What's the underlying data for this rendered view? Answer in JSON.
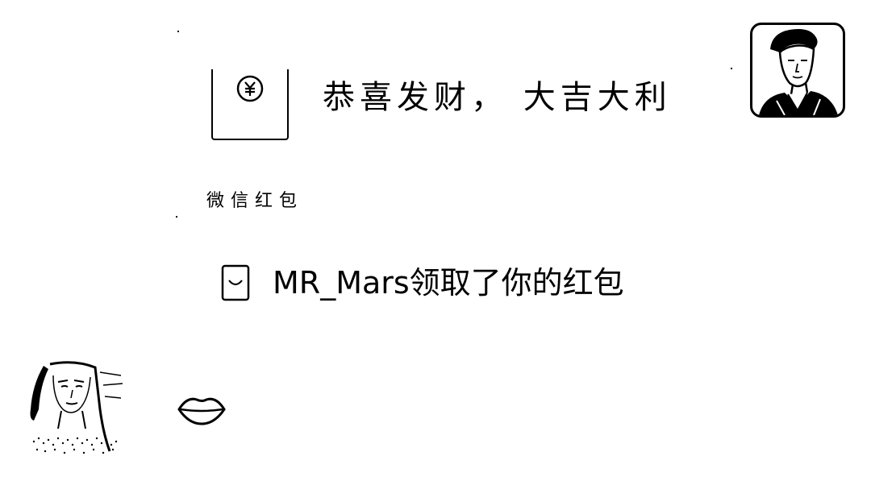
{
  "chat": {
    "red_packet": {
      "greeting": "恭喜发财， 大吉大利",
      "label": "微信红包",
      "icon": "yuan-coin-icon"
    },
    "system_notice": {
      "text": "MR_Mars领取了你的红包",
      "icon": "red-packet-icon"
    },
    "lips_message": {
      "icon": "lips-emoji-icon"
    },
    "avatars": {
      "self": "man-portrait-avatar",
      "other": "woman-portrait-avatar"
    }
  }
}
